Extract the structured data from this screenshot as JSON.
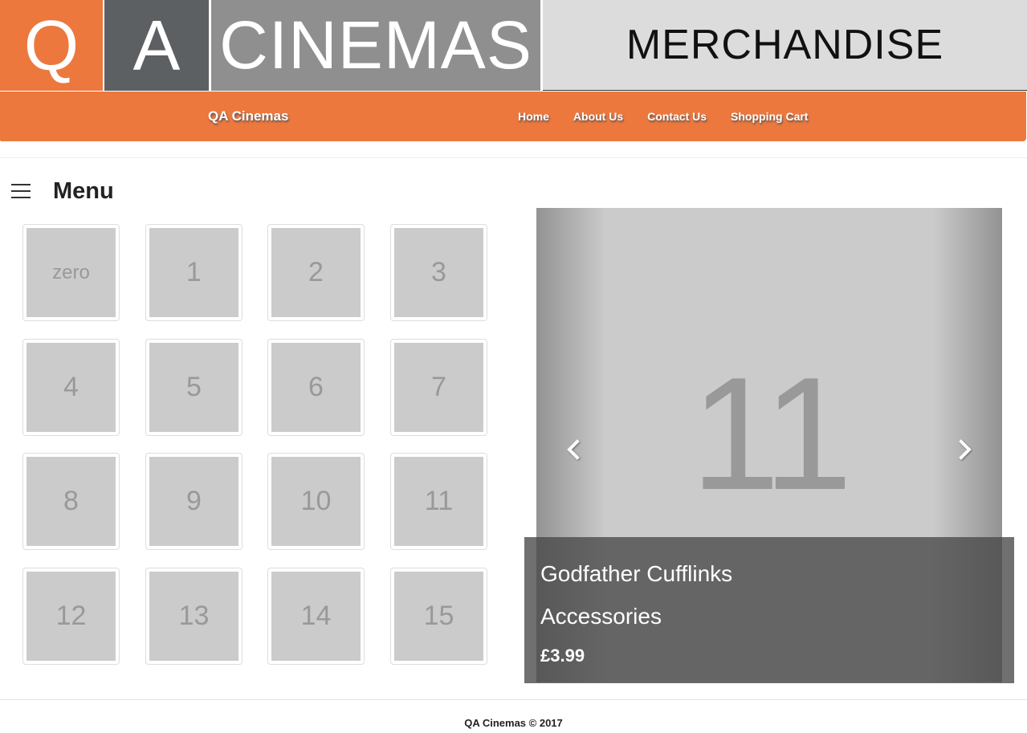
{
  "banner": {
    "logo_q": "Q",
    "logo_a": "A",
    "logo_cinemas": "CINEMAS",
    "section_title": "MERCHANDISE"
  },
  "navbar": {
    "brand": "QA Cinemas",
    "links": [
      "Home",
      "About Us",
      "Contact Us",
      "Shopping Cart"
    ]
  },
  "menu": {
    "icon": "hamburger-icon",
    "title": "Menu"
  },
  "grid": {
    "tiles": [
      "zero",
      "1",
      "2",
      "3",
      "4",
      "5",
      "6",
      "7",
      "8",
      "9",
      "10",
      "11",
      "12",
      "13",
      "14",
      "15"
    ]
  },
  "carousel": {
    "slide_label": "11",
    "prev_icon": "chevron-left-icon",
    "next_icon": "chevron-right-icon",
    "caption": {
      "title": "Godfather Cufflinks",
      "category": "Accessories",
      "price": "£3.99"
    }
  },
  "footer": {
    "text": "QA Cinemas © 2017"
  },
  "colors": {
    "brand_orange": "#ec783e",
    "logo_dark_gray": "#5c6062",
    "logo_mid_gray": "#8f8f8f",
    "banner_light_gray": "#dcdcdc",
    "placeholder_gray": "#cbcbcb"
  }
}
